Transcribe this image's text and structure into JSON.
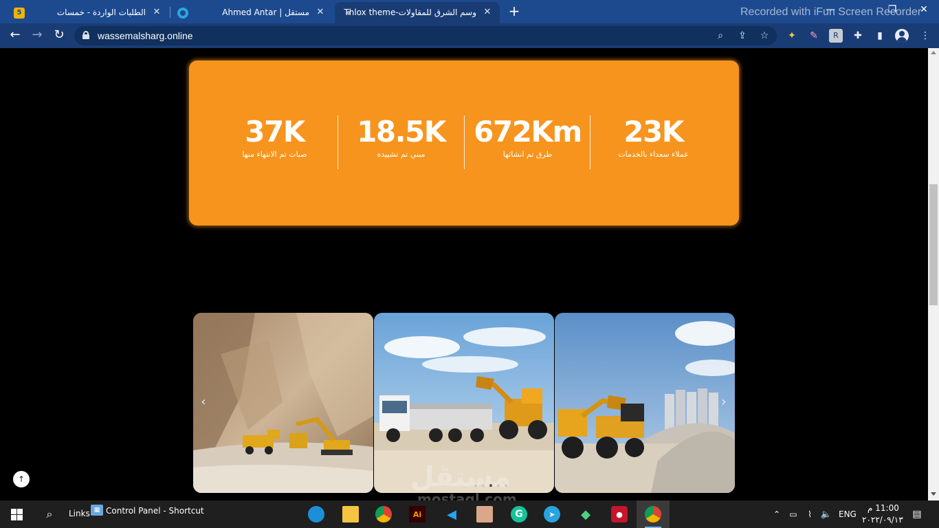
{
  "browser": {
    "tabs": [
      {
        "title": "الطلبات الواردة - خمسات",
        "favicon": "5"
      },
      {
        "title": "Ahmed Antar | مستقل",
        "favicon": ""
      },
      {
        "title": "وسم الشرق للمقاولات-Thlox theme",
        "favicon": ""
      }
    ],
    "recorder_overlay": "Recorded with iFun Screen Recorder",
    "url": "wassemalsharg.online"
  },
  "stats": [
    {
      "value": "23K",
      "label": "عملاء سعداء بالخدمات"
    },
    {
      "value": "672Km",
      "label": "طرق تم انشائها"
    },
    {
      "value": "18.5K",
      "label": "مبني تم تشييده"
    },
    {
      "value": "37K",
      "label": "صبات تم الانتهاء منها"
    }
  ],
  "gallery": {
    "slides": [
      "quarry-excavator-slide",
      "dump-truck-loader-slide",
      "loader-silos-slide"
    ],
    "active_dot": 1,
    "dot_count": 5
  },
  "watermark": {
    "line1": "مستقل",
    "line2": "mostaql.com"
  },
  "taskbar": {
    "links_label": "Links",
    "shortcut_label": "Control Panel - Shortcut",
    "language": "ENG",
    "time": "11:00 م",
    "date": "٢٠٢٢/٠٩/١٣"
  },
  "colors": {
    "accent": "#f7941d",
    "chrome": "#1a3c74",
    "tabbar": "#1d4a8f"
  }
}
